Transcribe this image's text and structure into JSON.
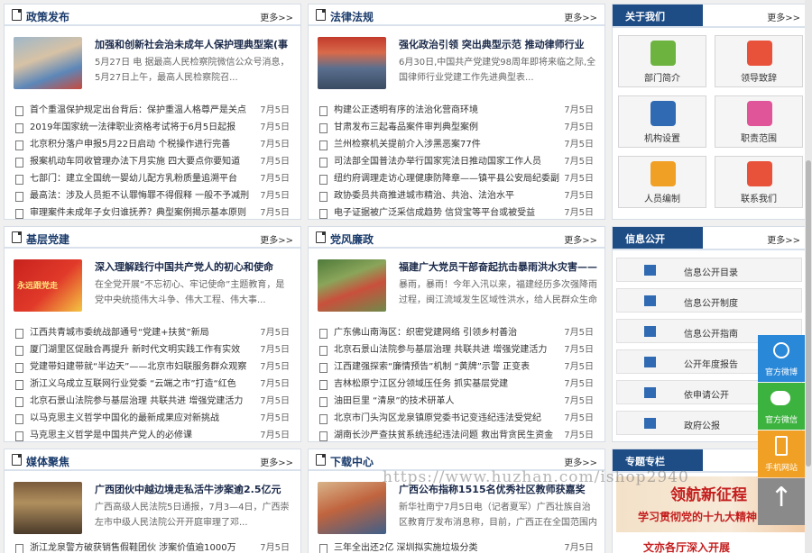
{
  "more_label": "更多>>",
  "policy": {
    "title": "政策发布",
    "feature_title": "加强和创新社会治未成年人保护理典型案(事",
    "feature_desc": "5月27日 电 据最高人民检察院微信公众号消息，5月27日上午，最高人民检察院召...",
    "items": [
      {
        "t": "首个重温保护规定出台背后：保护重温人格尊严是关点",
        "d": "7月5日"
      },
      {
        "t": "2019年国家统一法律职业资格考试将于6月5日起报",
        "d": "7月5日"
      },
      {
        "t": "北京积分落户申报5月22日启动 个税操作进行完善",
        "d": "7月5日"
      },
      {
        "t": "报案机动车同收管理办法下月实施 四大要点你要知道",
        "d": "7月5日"
      },
      {
        "t": "七部门：建立全国统一婴幼儿配方乳粉质量追溯平台",
        "d": "7月5日"
      },
      {
        "t": "最高法：涉及人员拒不认罪悔罪不得假释 一般不予减刑",
        "d": "7月5日"
      },
      {
        "t": "审理案件未成年子女归谁抚养？典型案例揭示基本原则",
        "d": "7月5日"
      }
    ]
  },
  "law": {
    "title": "法律法规",
    "feature_title": "强化政治引领 突出典型示范 推动律师行业",
    "feature_desc": "6月30日,中国共产党建党98周年即将来临之际,全国律师行业党建工作先进典型表...",
    "items": [
      {
        "t": "构建公正透明有序的法治化营商环境",
        "d": "7月5日"
      },
      {
        "t": "甘肃发布三起毒品案件审判典型案例",
        "d": "7月5日"
      },
      {
        "t": "兰州检察机关提前介入涉黑恶案77件",
        "d": "7月5日"
      },
      {
        "t": "司法部全国普法办举行国家宪法日推动国家工作人员",
        "d": "7月5日"
      },
      {
        "t": "纽约府调理走访心理健康防降章——镇平县公安局纪委副",
        "d": "7月5日"
      },
      {
        "t": "政协委员共商推进城市精治、共治、法治水平",
        "d": "7月5日"
      },
      {
        "t": "电子证据被广泛采信成趋势 信贷宝等平台或被受益",
        "d": "7月5日"
      }
    ]
  },
  "party": {
    "title": "基层党建",
    "feature_title": "深入理解践行中国共产党人的初心和使命",
    "feature_desc": "在全党开展“不忘初心、牢记使命”主题教育，是党中央统揽伟大斗争、伟大工程、伟大事...",
    "photo_text": "永远跟党走",
    "items": [
      {
        "t": "江西共青城市委统战部通号“党建+扶贫”新局",
        "d": "7月5日"
      },
      {
        "t": "厦门湖里区促融合再提升 新时代文明实践工作有实效",
        "d": "7月5日"
      },
      {
        "t": "党建带妇建带就“半边天”——北京市妇联服务群众观察",
        "d": "7月5日"
      },
      {
        "t": "浙江义乌成立互联网行业党委 “云端之市”打造“红色",
        "d": "7月5日"
      },
      {
        "t": "北京石景山法院参与基层治理 共联共进 增强党建活力",
        "d": "7月5日"
      },
      {
        "t": "以马克思主义哲学中国化的最新成果应对新挑战",
        "d": "7月5日"
      },
      {
        "t": "马克思主义哲学是中国共产党人的必修课",
        "d": "7月5日"
      }
    ]
  },
  "clean": {
    "title": "党风廉政",
    "feature_title": "福建广大党员干部奋起抗击暴雨洪水灾害——",
    "feature_desc": "暴雨，暴雨！今年入汛以来，福建经历多次强降雨过程，闽江流域发生区域性洪水，给人民群众生命财...",
    "items": [
      {
        "t": "广东佛山南海区：织密党建网络 引领乡村善治",
        "d": "7月5日"
      },
      {
        "t": "北京石景山法院参与基层治理 共联共进 增强党建活力",
        "d": "7月5日"
      },
      {
        "t": "江西建强探索“廉情预告”机制 “黄牌”示警 正变表",
        "d": "7月5日"
      },
      {
        "t": "吉林松原宁江区分领域压任务 抓实基层党建",
        "d": "7月5日"
      },
      {
        "t": "油田巨里 “清泉”的技术研革人",
        "d": "7月5日"
      },
      {
        "t": "北京市门头沟区龙泉镇原党委书记变违纪违法受党纪",
        "d": "7月5日"
      },
      {
        "t": "湖南长沙严查扶贫系统违纪违法问题 救出背贪民生资金",
        "d": "7月5日"
      }
    ]
  },
  "media": {
    "title": "媒体聚焦",
    "feature_title": "广西团伙中越边境走私活牛涉案逾2.5亿元",
    "feature_desc": "广西高级人民法院5日通报，7月3—4日，广西崇左市中级人民法院公开开庭审理了邓...",
    "items": [
      {
        "t": "浙江龙泉警方破获销售假鞋团伙 涉案价值逾1000万",
        "d": "7月5日"
      }
    ]
  },
  "download": {
    "title": "下载中心",
    "feature_title": "广西公布指称1515名优秀社区教师获嘉奖",
    "feature_desc": "新华社南宁7月5日电（记者夏军）广西壮族自治区教育厅发布消息称，目前，广西正在全国范围内公...",
    "items": [
      {
        "t": "三年全出还2亿 深圳拟实施垃圾分类",
        "d": "7月5日"
      }
    ]
  },
  "about": {
    "title": "关于我们",
    "tiles": [
      {
        "label": "部门简介",
        "color": "#6db33f"
      },
      {
        "label": "领导致辞",
        "color": "#e8523a"
      },
      {
        "label": "机构设置",
        "color": "#2f6ab3"
      },
      {
        "label": "职责范围",
        "color": "#e0559a"
      },
      {
        "label": "人员编制",
        "color": "#f0a024"
      },
      {
        "label": "联系我们",
        "color": "#e8523a"
      }
    ]
  },
  "info": {
    "title": "信息公开",
    "items": [
      "信息公开目录",
      "信息公开制度",
      "信息公开指南",
      "公开年度报告",
      "依申请公开",
      "政府公报"
    ]
  },
  "special": {
    "title": "专题专栏",
    "banner_line1": "领航新征程",
    "banner_line2": "学习贯彻党的十九大精神",
    "banner_line3": "文亦各厅深入开展"
  },
  "side": {
    "weibo": "官方微博",
    "wechat": "官方微信",
    "mobile": "手机网站",
    "top_arrow": "↑"
  },
  "watermark": "https://www.huzhan.com/ishop2940"
}
